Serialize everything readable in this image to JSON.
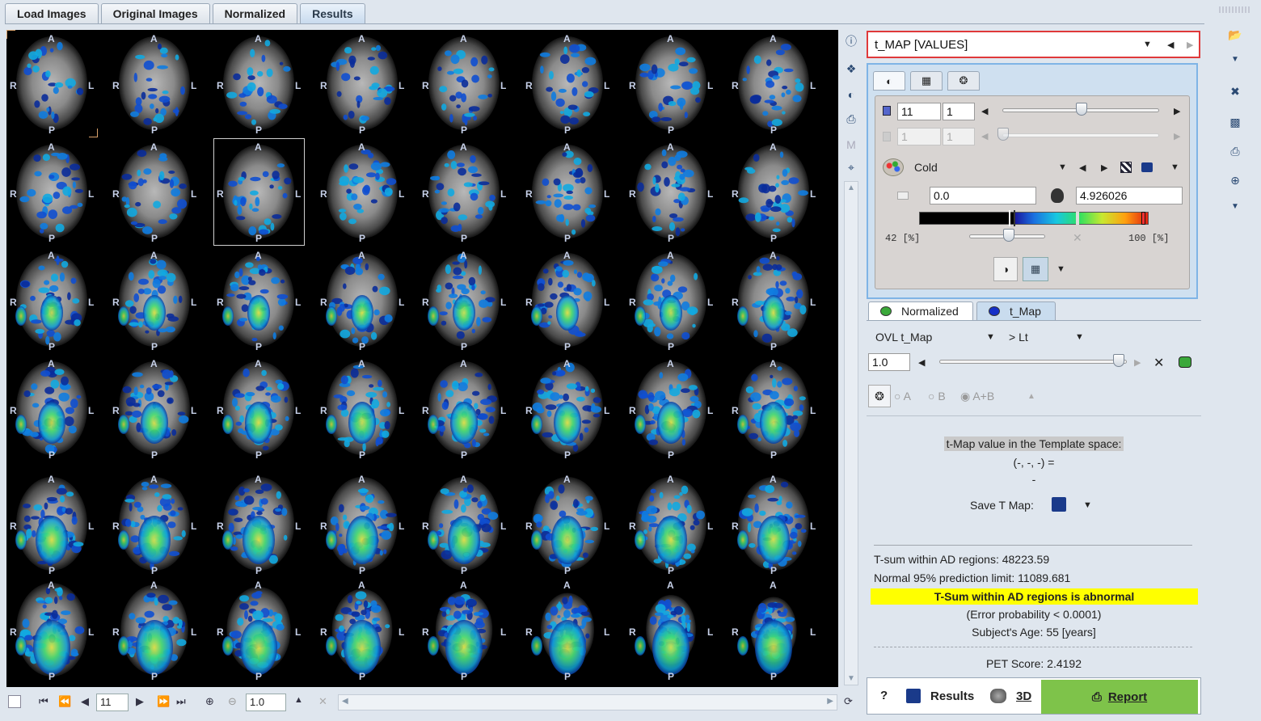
{
  "tabs": [
    "Load Images",
    "Original Images",
    "Normalized",
    "Results"
  ],
  "active_tab": "Results",
  "slice_labels": {
    "anterior": "A",
    "posterior": "P",
    "right": "R",
    "left": "L"
  },
  "bottom_toolbar": {
    "slice_value": "11",
    "zoom_value": "1.0"
  },
  "map_selector": {
    "value": "t_MAP [VALUES]"
  },
  "lut": {
    "slice_a": "11",
    "slice_b": "1",
    "slice_c": "1",
    "slice_d": "1",
    "colormap": "Cold",
    "min_value": "0.0",
    "max_value": "4.926026",
    "pct_low": "42  [%]",
    "pct_high": "100  [%]"
  },
  "overlay_tabs": {
    "first": "Normalized",
    "second": "t_Map"
  },
  "overlay": {
    "ovl_name": "OVL  t_Map",
    "mode": "> Lt",
    "threshold": "1.0",
    "opt_a": "A",
    "opt_b": "B",
    "opt_ab": "A+B"
  },
  "tmap_info": {
    "label": "t-Map value in the Template space:",
    "coords": "(-, -, -) =",
    "value": "-",
    "save_label": "Save T Map:"
  },
  "results": {
    "tsum": "T-sum within AD regions: 48223.59",
    "limit": "Normal 95% prediction limit: 11089.681",
    "abnormal": "T-Sum within AD regions is abnormal",
    "error": "(Error probability < 0.0001)",
    "age": "Subject's Age: 55 [years]",
    "pet_score": "PET Score: 2.4192"
  },
  "actions": {
    "help": "?",
    "results": "Results",
    "three_d": "3D",
    "report": "Report"
  }
}
